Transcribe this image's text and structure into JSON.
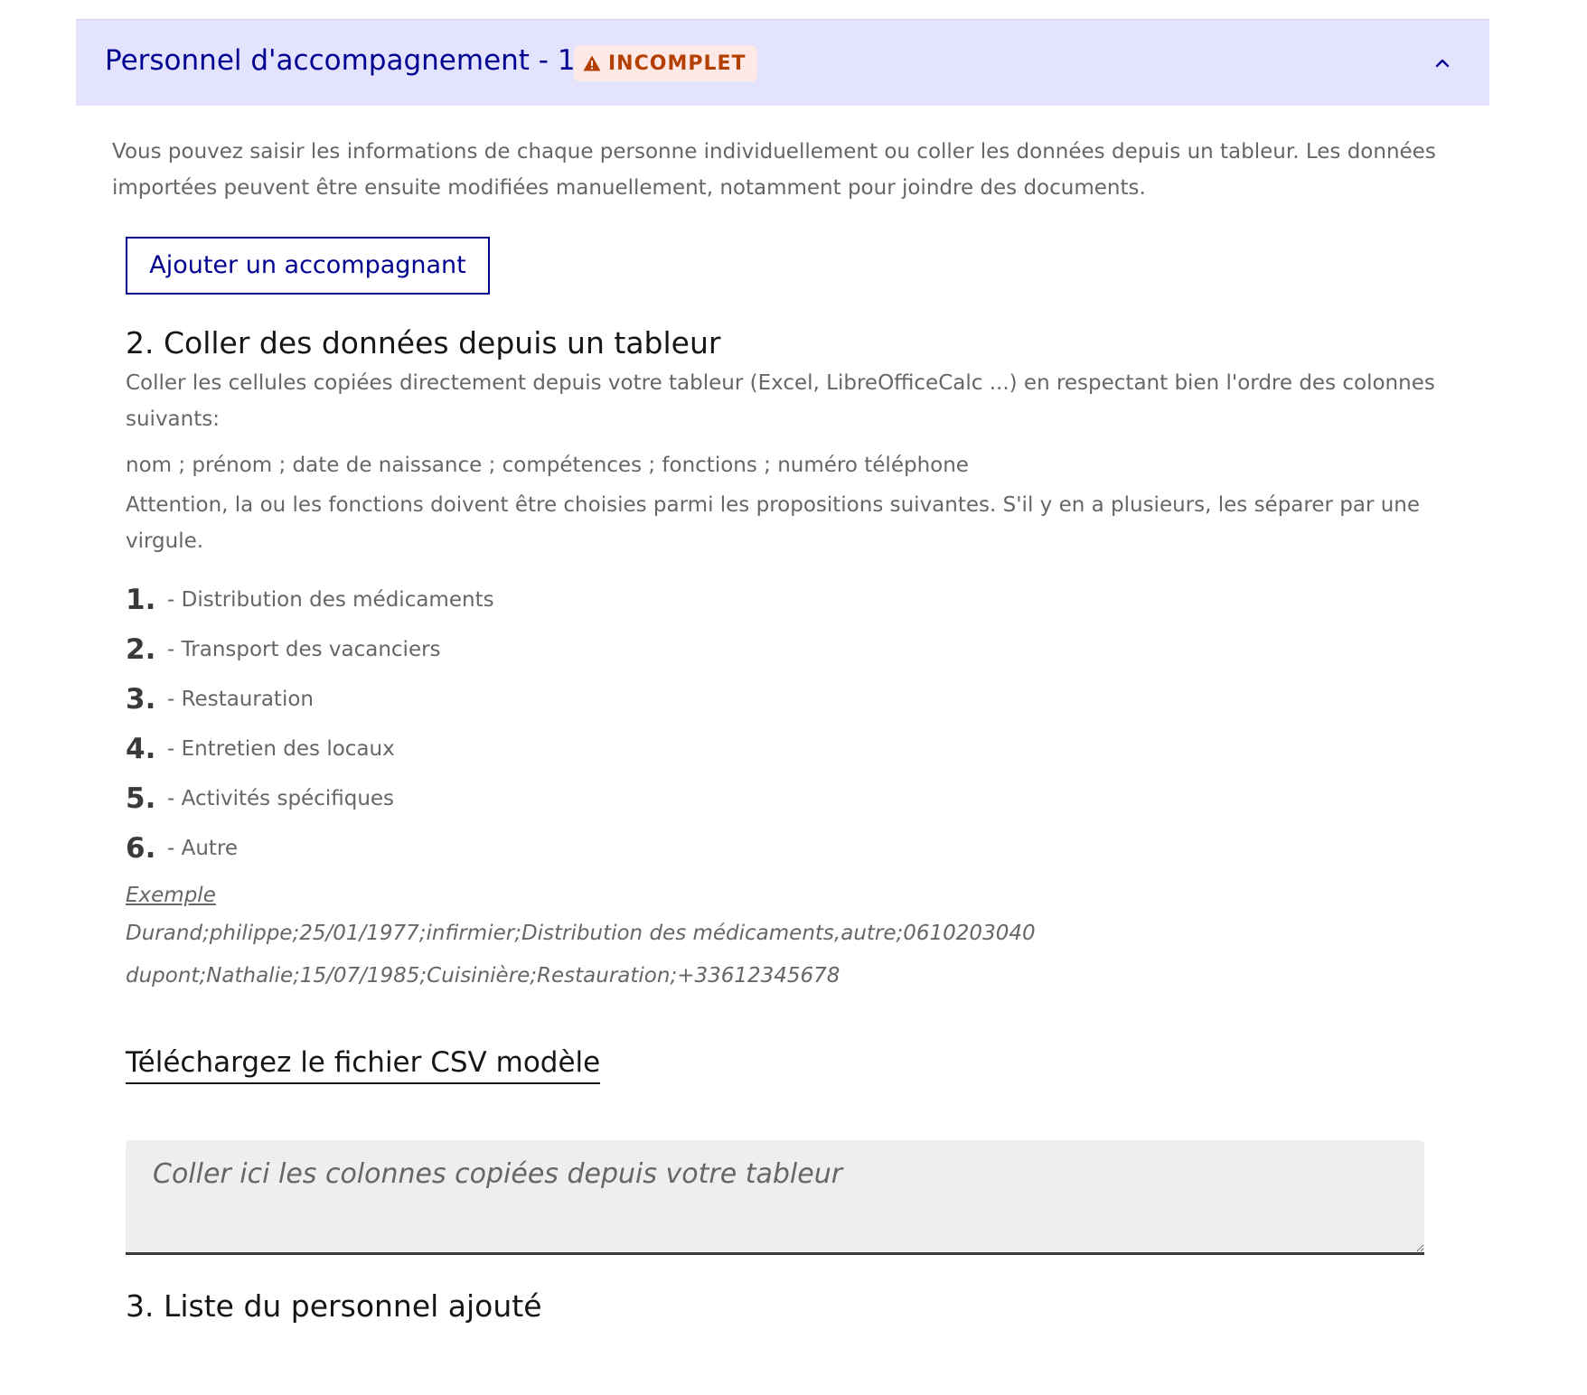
{
  "accordion": {
    "title": "Personnel d'accompagnement - 1",
    "badge": "INCOMPLET",
    "badge_icon": "warning-icon",
    "chevron_icon": "chevron-up-icon",
    "colors": {
      "header_bg": "#e3e3fd",
      "title": "#000091",
      "badge_bg": "#ffe9e6",
      "badge_text": "#b34000"
    }
  },
  "intro": "Vous pouvez saisir les informations de chaque personne individuellement ou coller les données depuis un tableur. Les données importées peuvent être ensuite modifiées manuellement, notamment pour joindre des documents.",
  "add_button_label": "Ajouter un accompagnant",
  "paste_section": {
    "heading": "2. Coller des données depuis un tableur",
    "description": "Coller les cellules copiées directement depuis votre tableur (Excel, LibreOfficeCalc ...) en respectant bien l'ordre des colonnes suivants:",
    "columns": "nom ; prénom ; date de naissance ; compétences ; fonctions ; numéro téléphone",
    "attention": "Attention, la ou les fonctions doivent être choisies parmi les propositions suivantes. S'il y en a plusieurs, les séparer par une virgule.",
    "functions": [
      {
        "num": "1.",
        "label": "- Distribution des médicaments"
      },
      {
        "num": "2.",
        "label": "- Transport des vacanciers"
      },
      {
        "num": "3.",
        "label": "- Restauration"
      },
      {
        "num": "4.",
        "label": "- Entretien des locaux"
      },
      {
        "num": "5.",
        "label": "- Activités spécifiques"
      },
      {
        "num": "6.",
        "label": "- Autre"
      }
    ],
    "example_title": "Exemple",
    "example_lines": [
      "Durand;philippe;25/01/1977;infirmier;Distribution des médicaments,autre;0610203040",
      "dupont;Nathalie;15/07/1985;Cuisinière;Restauration;+33612345678"
    ],
    "csv_link": "Téléchargez le fichier CSV modèle",
    "textarea": {
      "value": "",
      "placeholder": "Coller ici les colonnes copiées depuis votre tableur"
    }
  },
  "list_section": {
    "heading": "3. Liste du personnel ajouté"
  }
}
